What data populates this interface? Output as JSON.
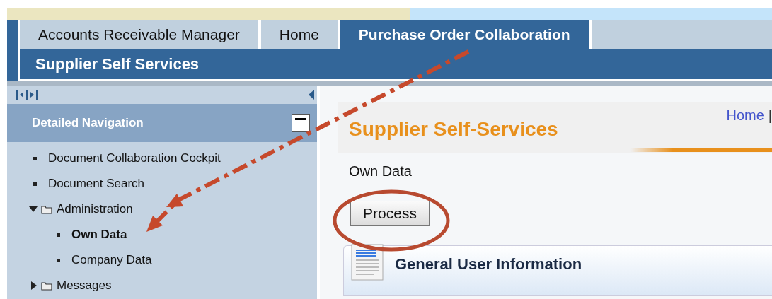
{
  "top_tabs": [
    {
      "label": "Accounts Receivable Manager",
      "selected": false
    },
    {
      "label": "Home",
      "selected": false
    },
    {
      "label": "Purchase Order Collaboration",
      "selected": true
    }
  ],
  "sub_nav": {
    "label": "Supplier Self Services"
  },
  "sidebar": {
    "title": "Detailed Navigation",
    "items": [
      {
        "label": "Document Collaboration Cockpit",
        "kind": "link",
        "selected": false
      },
      {
        "label": "Document Search",
        "kind": "link",
        "selected": false
      },
      {
        "label": "Administration",
        "kind": "folder",
        "expanded": true,
        "children": [
          {
            "label": "Own Data",
            "kind": "link",
            "selected": true
          },
          {
            "label": "Company Data",
            "kind": "link",
            "selected": false
          }
        ]
      },
      {
        "label": "Messages",
        "kind": "folder",
        "expanded": false
      }
    ]
  },
  "page": {
    "title": "Supplier Self-Services",
    "breadcrumb": {
      "link": "Home",
      "separator": "|"
    },
    "subtitle": "Own Data",
    "button": "Process",
    "section_title": "General User Information"
  }
}
